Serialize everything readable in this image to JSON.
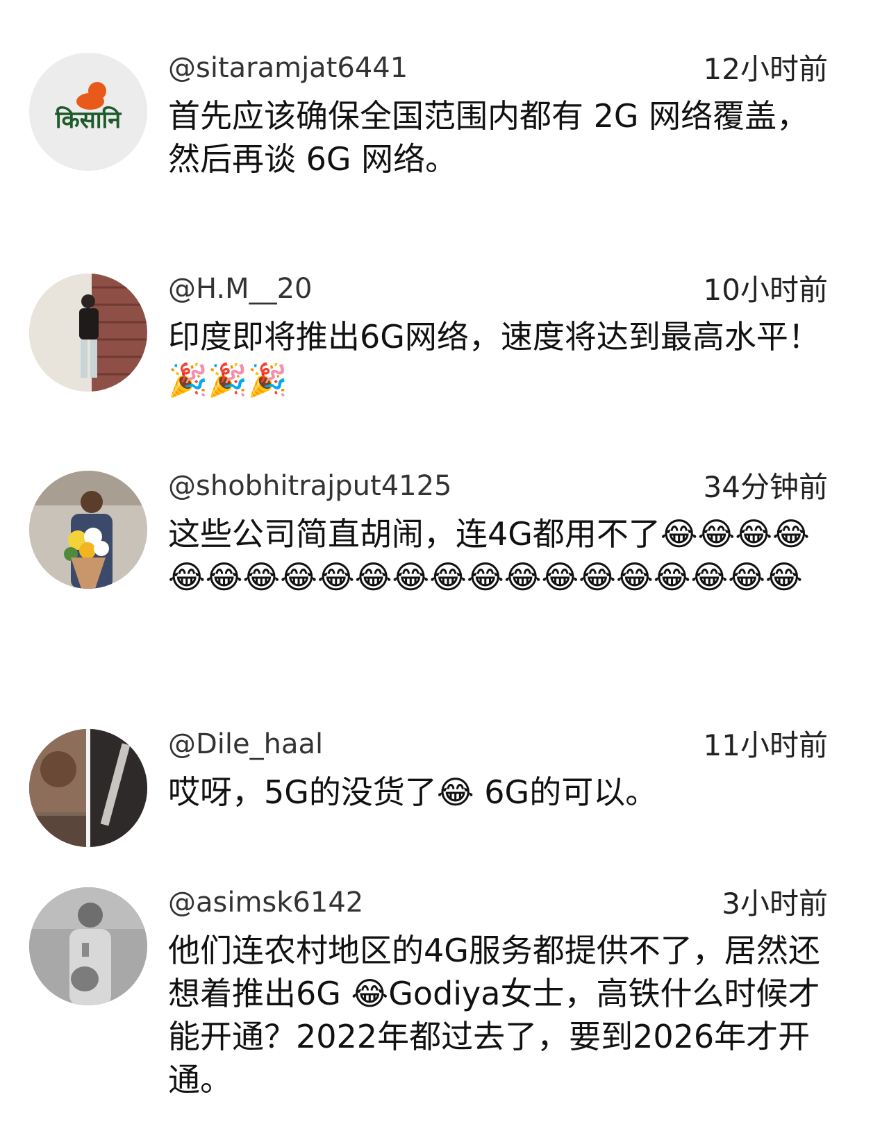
{
  "comments": [
    {
      "username": "@sitaramjat6441",
      "time": "12小时前",
      "text": "首先应该确保全国范围内都有 2G 网络覆盖，然后再谈 6G 网络。",
      "avatar_logo_text": "किसानि"
    },
    {
      "username": "@H.M__20",
      "time": "10小时前",
      "text": "印度即将推出6G网络，速度将达到最高水平！ 🎉🎉🎉"
    },
    {
      "username": "@shobhitrajput4125",
      "time": "34分钟前",
      "text": "这些公司简直胡闹，连4G都用不了😂😂😂😂😂😂😂😂😂😂😂😂😂😂😂😂😂😂😂😂😂"
    },
    {
      "username": "@Dile_haal",
      "time": "11小时前",
      "text": "哎呀，5G的没货了😂 6G的可以。"
    },
    {
      "username": "@asimsk6142",
      "time": "3小时前",
      "text": "他们连农村地区的4G服务都提供不了，居然还想着推出6G 😂Godiya女士，高铁什么时候才能开通？2022年都过去了，要到2026年才开通。"
    }
  ],
  "colors": {
    "background": "#ffffff",
    "text": "#111111",
    "username": "#333333"
  }
}
